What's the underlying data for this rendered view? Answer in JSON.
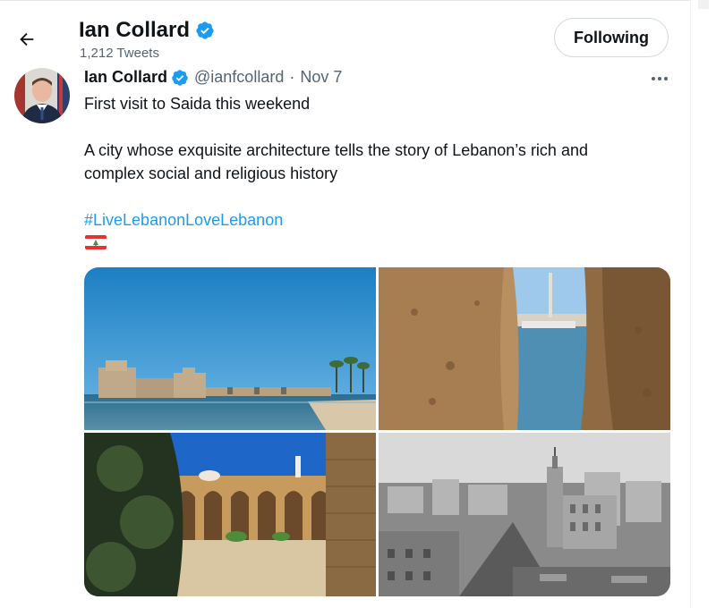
{
  "header": {
    "name": "Ian Collard",
    "tweet_count": "1,212 Tweets",
    "follow_label": "Following"
  },
  "tweet": {
    "author_name": "Ian Collard",
    "handle": "@ianfcollard",
    "separator": "·",
    "date": "Nov 7",
    "line1": "First visit to Saida this weekend",
    "line2": "A city whose exquisite architecture tells the story of Lebanon’s rich and",
    "line3": "complex social and religious history",
    "hashtag": "#LiveLebanonLoveLebanon",
    "emoji_flag": "lebanon-flag-emoji"
  },
  "photos": [
    {
      "name": "sea-castle-photo"
    },
    {
      "name": "harbor-through-wall-photo"
    },
    {
      "name": "courtyard-arches-photo"
    },
    {
      "name": "city-rooftops-bw-photo"
    }
  ],
  "colors": {
    "accent": "#1d9bf0",
    "text_primary": "#0f1419",
    "text_secondary": "#536471",
    "border": "#cfd9de"
  },
  "icons": {
    "back": "arrow-left-icon",
    "verified": "verified-badge-icon",
    "more": "more-horizontal-icon"
  }
}
